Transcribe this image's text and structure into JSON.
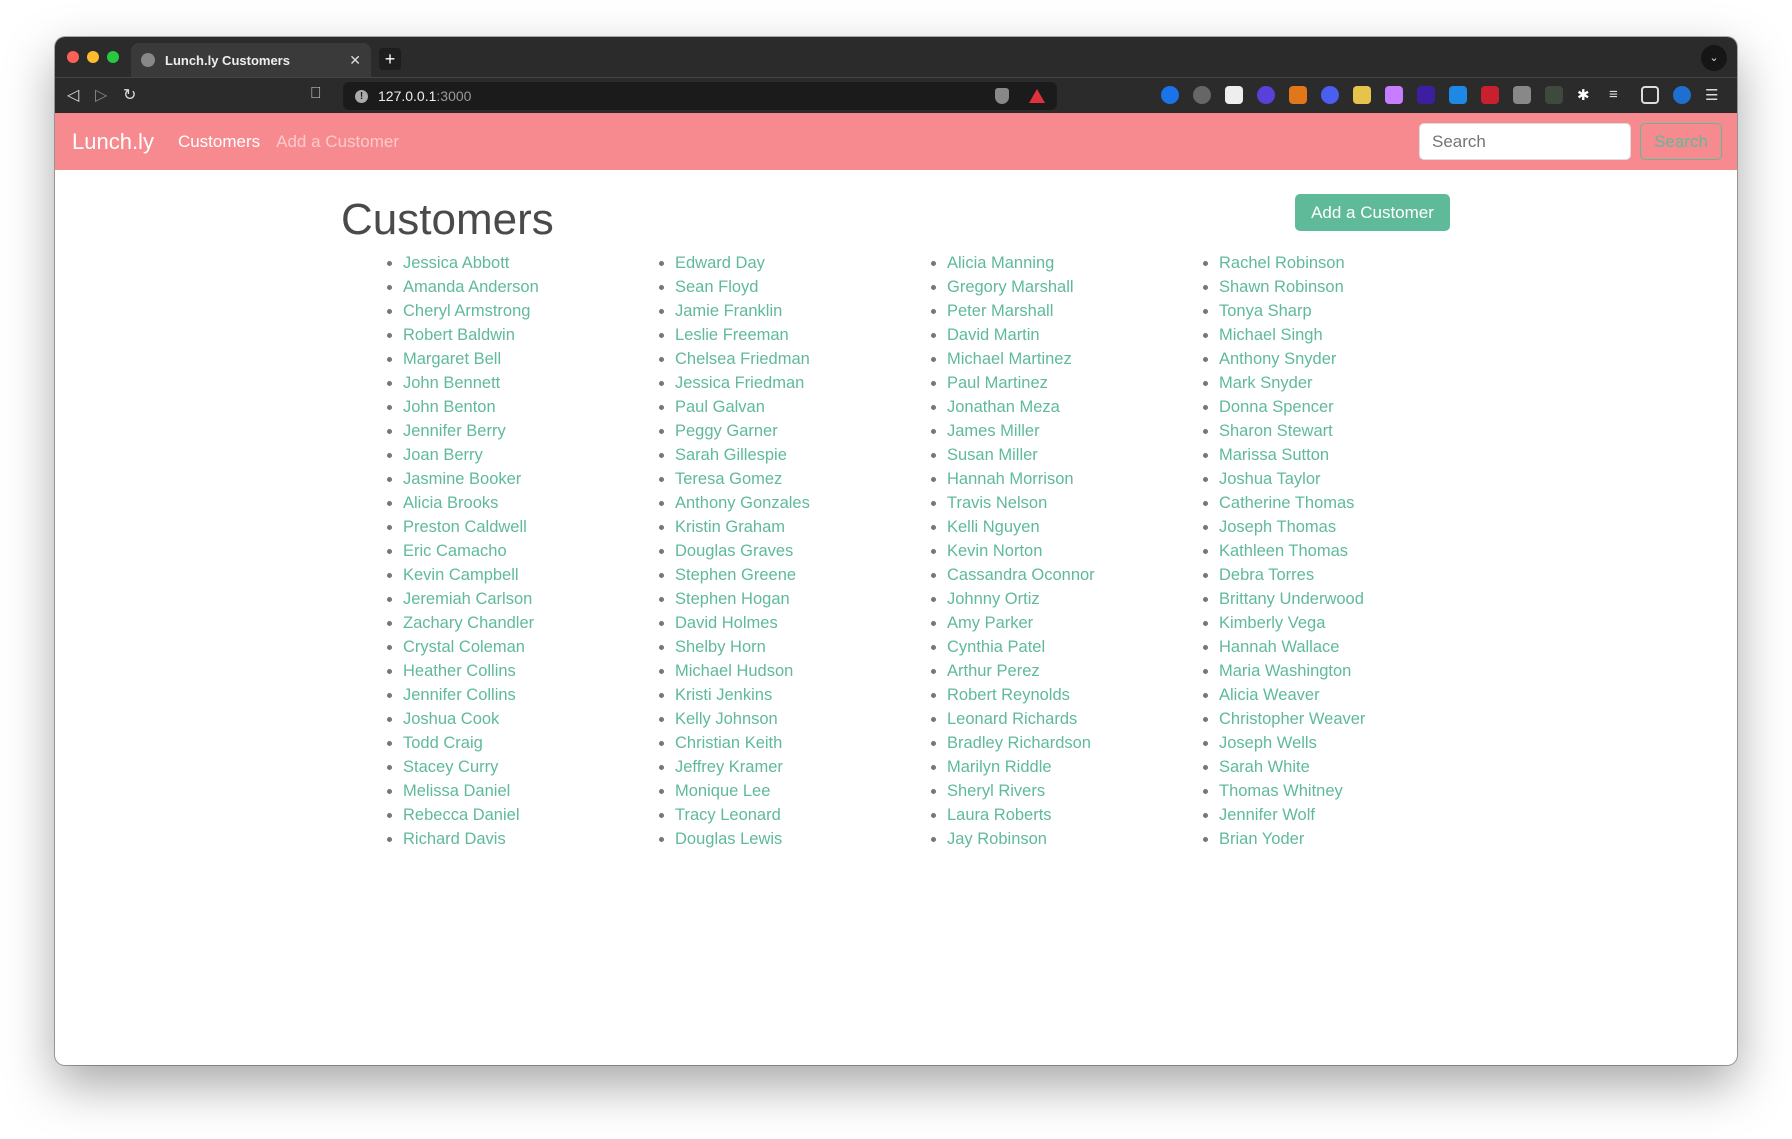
{
  "browser": {
    "tab_title": "Lunch.ly Customers",
    "url_host": "127.0.0.1",
    "url_port": ":3000"
  },
  "navbar": {
    "brand": "Lunch.ly",
    "links": [
      "Customers",
      "Add a Customer"
    ],
    "search_placeholder": "Search",
    "search_button": "Search"
  },
  "page": {
    "title": "Customers",
    "add_button": "Add a Customer"
  },
  "customers": [
    [
      "Jessica Abbott",
      "Amanda Anderson",
      "Cheryl Armstrong",
      "Robert Baldwin",
      "Margaret Bell",
      "John Bennett",
      "John Benton",
      "Jennifer Berry",
      "Joan Berry",
      "Jasmine Booker",
      "Alicia Brooks",
      "Preston Caldwell",
      "Eric Camacho",
      "Kevin Campbell",
      "Jeremiah Carlson",
      "Zachary Chandler",
      "Crystal Coleman",
      "Heather Collins",
      "Jennifer Collins",
      "Joshua Cook",
      "Todd Craig",
      "Stacey Curry",
      "Melissa Daniel",
      "Rebecca Daniel",
      "Richard Davis"
    ],
    [
      "Edward Day",
      "Sean Floyd",
      "Jamie Franklin",
      "Leslie Freeman",
      "Chelsea Friedman",
      "Jessica Friedman",
      "Paul Galvan",
      "Peggy Garner",
      "Sarah Gillespie",
      "Teresa Gomez",
      "Anthony Gonzales",
      "Kristin Graham",
      "Douglas Graves",
      "Stephen Greene",
      "Stephen Hogan",
      "David Holmes",
      "Shelby Horn",
      "Michael Hudson",
      "Kristi Jenkins",
      "Kelly Johnson",
      "Christian Keith",
      "Jeffrey Kramer",
      "Monique Lee",
      "Tracy Leonard",
      "Douglas Lewis"
    ],
    [
      "Alicia Manning",
      "Gregory Marshall",
      "Peter Marshall",
      "David Martin",
      "Michael Martinez",
      "Paul Martinez",
      "Jonathan Meza",
      "James Miller",
      "Susan Miller",
      "Hannah Morrison",
      "Travis Nelson",
      "Kelli Nguyen",
      "Kevin Norton",
      "Cassandra Oconnor",
      "Johnny Ortiz",
      "Amy Parker",
      "Cynthia Patel",
      "Arthur Perez",
      "Robert Reynolds",
      "Leonard Richards",
      "Bradley Richardson",
      "Marilyn Riddle",
      "Sheryl Rivers",
      "Laura Roberts",
      "Jay Robinson"
    ],
    [
      "Rachel Robinson",
      "Shawn Robinson",
      "Tonya Sharp",
      "Michael Singh",
      "Anthony Snyder",
      "Mark Snyder",
      "Donna Spencer",
      "Sharon Stewart",
      "Marissa Sutton",
      "Joshua Taylor",
      "Catherine Thomas",
      "Joseph Thomas",
      "Kathleen Thomas",
      "Debra Torres",
      "Brittany Underwood",
      "Kimberly Vega",
      "Hannah Wallace",
      "Maria Washington",
      "Alicia Weaver",
      "Christopher Weaver",
      "Joseph Wells",
      "Sarah White",
      "Thomas Whitney",
      "Jennifer Wolf",
      "Brian Yoder"
    ]
  ],
  "colors": {
    "navbar": "#f68a8f",
    "accent": "#5fba9a"
  }
}
